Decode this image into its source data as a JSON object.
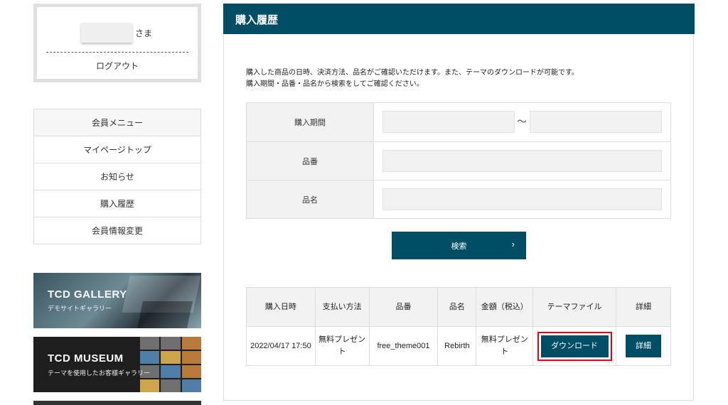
{
  "sidebar": {
    "user_suffix": "さま",
    "logout_label": "ログアウト",
    "menu": [
      {
        "label": "会員メニュー"
      },
      {
        "label": "マイページトップ"
      },
      {
        "label": "お知らせ"
      },
      {
        "label": "購入履歴"
      },
      {
        "label": "会員情報変更"
      }
    ],
    "banners": [
      {
        "title": "TCD GALLERY",
        "subtitle": "デモサイトギャラリー"
      },
      {
        "title": "TCD MUSEUM",
        "subtitle": "テーマを使用したお客様ギャラリー"
      }
    ]
  },
  "main": {
    "title": "購入履歴",
    "intro_line1": "購入した商品の日時、決済方法、品名がご確認いただけます。また、テーマのダウンロードが可能です。",
    "intro_line2": "購入期間・品番・品名から検索をしてご確認ください。",
    "form": {
      "period_label": "購入期間",
      "period_separator": "～",
      "number_label": "品番",
      "name_label": "品名"
    },
    "search_label": "検索",
    "search_arrow": "›",
    "table": {
      "headers": [
        "購入日時",
        "支払い方法",
        "品番",
        "品名",
        "金額（税込）",
        "テーマファイル",
        "詳細"
      ],
      "row": {
        "date": "2022/04/17 17:50",
        "payment": "無料プレゼント",
        "number": "free_theme001",
        "name": "Rebirth",
        "price": "無料プレゼント",
        "download_label": "ダウンロード",
        "detail_label": "詳細"
      }
    }
  },
  "colors": {
    "brand": "#004d66",
    "highlight": "#e60012"
  }
}
